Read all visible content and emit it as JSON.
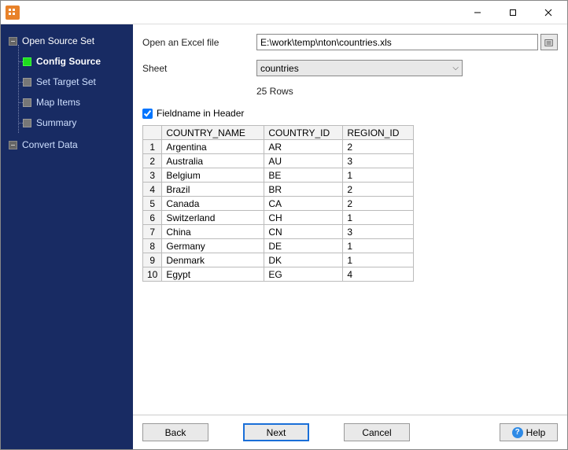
{
  "sidebar": {
    "items": [
      {
        "label": "Open Source Set",
        "type": "parent"
      },
      {
        "label": "Config Source",
        "type": "child",
        "active": true
      },
      {
        "label": "Set Target Set",
        "type": "child"
      },
      {
        "label": "Map Items",
        "type": "child"
      },
      {
        "label": "Summary",
        "type": "child"
      },
      {
        "label": "Convert Data",
        "type": "parent"
      }
    ]
  },
  "form": {
    "open_file_label": "Open an Excel file",
    "file_path": "E:\\work\\temp\\nton\\countries.xls",
    "sheet_label": "Sheet",
    "sheet_value": "countries",
    "row_count": "25 Rows",
    "fieldname_checkbox": "Fieldname in Header",
    "fieldname_checked": true
  },
  "grid": {
    "columns": [
      "COUNTRY_NAME",
      "COUNTRY_ID",
      "REGION_ID"
    ],
    "rows": [
      {
        "n": "1",
        "name": "Argentina",
        "id": "AR",
        "reg": "2"
      },
      {
        "n": "2",
        "name": "Australia",
        "id": "AU",
        "reg": "3"
      },
      {
        "n": "3",
        "name": "Belgium",
        "id": "BE",
        "reg": "1"
      },
      {
        "n": "4",
        "name": "Brazil",
        "id": "BR",
        "reg": "2"
      },
      {
        "n": "5",
        "name": "Canada",
        "id": "CA",
        "reg": "2"
      },
      {
        "n": "6",
        "name": "Switzerland",
        "id": "CH",
        "reg": "1"
      },
      {
        "n": "7",
        "name": "China",
        "id": "CN",
        "reg": "3"
      },
      {
        "n": "8",
        "name": "Germany",
        "id": "DE",
        "reg": "1"
      },
      {
        "n": "9",
        "name": "Denmark",
        "id": "DK",
        "reg": "1"
      },
      {
        "n": "10",
        "name": "Egypt",
        "id": "EG",
        "reg": "4"
      }
    ]
  },
  "footer": {
    "back": "Back",
    "next": "Next",
    "cancel": "Cancel",
    "help": "Help"
  }
}
